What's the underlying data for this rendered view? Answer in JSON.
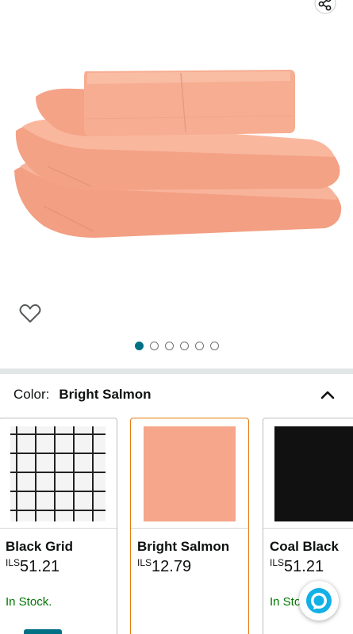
{
  "icons": {
    "share": "share-icon",
    "wishlist": "heart-icon",
    "collapse": "chevron-up-icon",
    "assistant": "alexa-icon"
  },
  "carousel": {
    "total": 6,
    "active_index": 0
  },
  "colors": {
    "accent": "#007185",
    "selected_border": "#e47911",
    "in_stock": "#007600",
    "sheet": "#f5a68b"
  },
  "color_selector": {
    "label": "Color:",
    "selected": "Bright Salmon"
  },
  "swatches": [
    {
      "name": "Black Grid",
      "currency": "ILS",
      "amount": "51.21",
      "stock": "In Stock."
    },
    {
      "name": "Bright Salmon",
      "currency": "ILS",
      "amount": "12.79",
      "stock": ""
    },
    {
      "name": "Coal Black",
      "currency": "ILS",
      "amount": "51.21",
      "stock": "In Stock."
    }
  ]
}
